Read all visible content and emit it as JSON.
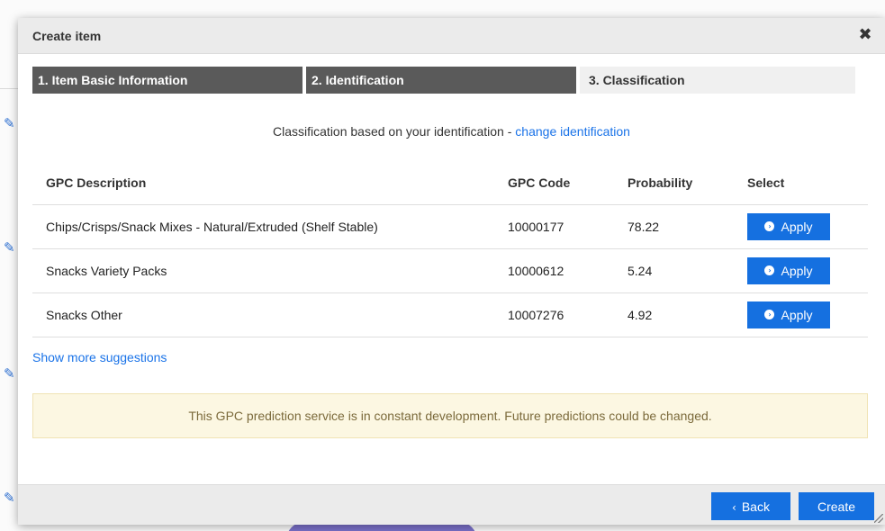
{
  "modal": {
    "title": "Create item",
    "close_glyph": "✖"
  },
  "steps": [
    {
      "label": "1. Item Basic Information"
    },
    {
      "label": "2. Identification"
    },
    {
      "label": "3. Classification"
    }
  ],
  "intro": {
    "text": "Classification based on your identification - ",
    "link": "change identification"
  },
  "table": {
    "headers": {
      "description": "GPC Description",
      "code": "GPC Code",
      "probability": "Probability",
      "select": "Select"
    },
    "rows": [
      {
        "description": "Chips/Crisps/Snack Mixes - Natural/Extruded (Shelf Stable)",
        "code": "10000177",
        "probability": "78.22",
        "action": "Apply"
      },
      {
        "description": "Snacks Variety Packs",
        "code": "10000612",
        "probability": "5.24",
        "action": "Apply"
      },
      {
        "description": "Snacks Other",
        "code": "10007276",
        "probability": "4.92",
        "action": "Apply"
      }
    ]
  },
  "more_suggestions": "Show more suggestions",
  "notice": "This GPC prediction service is in constant development. Future predictions could be changed.",
  "footer": {
    "back_label": "Back",
    "create_label": "Create"
  },
  "colors": {
    "primary": "#1570e0",
    "step_active_bg": "#5a5a5a",
    "notice_bg": "#fcf7e2"
  }
}
